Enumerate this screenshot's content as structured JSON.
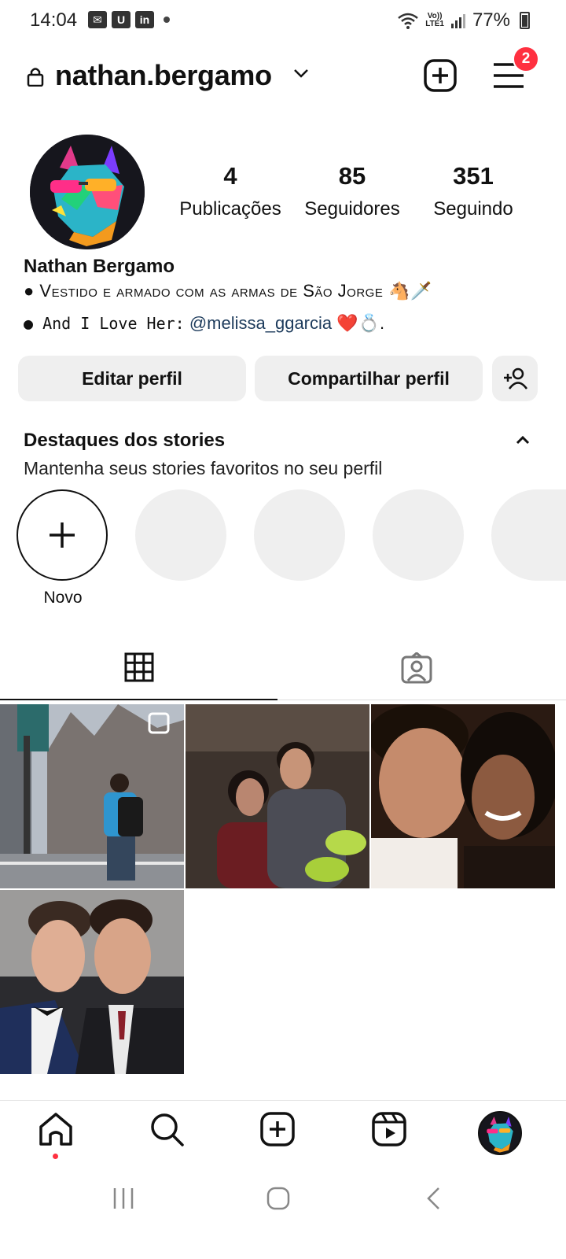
{
  "status_bar": {
    "time": "14:04",
    "notification_icons": [
      "message-icon",
      "u-app-icon",
      "linkedin-icon"
    ],
    "network": "LTE1",
    "volte": "Vo))",
    "battery": "77%"
  },
  "header": {
    "username": "nathan.bergamo",
    "notification_count": "2"
  },
  "profile": {
    "stats": [
      {
        "value": "4",
        "label": "Publicações"
      },
      {
        "value": "85",
        "label": "Seguidores"
      },
      {
        "value": "351",
        "label": "Seguindo"
      }
    ],
    "full_name": "Nathan Bergamo",
    "bio_line1": "● Vestido e armado com as armas de São Jorge 🐴🗡️",
    "bio_line2_prefix": "● And I Love Her:",
    "bio_line2_mention": "@melissa_ggarcia",
    "bio_line2_suffix": "❤️💍."
  },
  "actions": {
    "edit": "Editar perfil",
    "share": "Compartilhar perfil"
  },
  "highlights": {
    "title": "Destaques dos stories",
    "subtitle": "Mantenha seus stories favoritos no seu perfil",
    "new_label": "Novo"
  },
  "colors": {
    "badge": "#ff3040",
    "button_bg": "#efefef",
    "link": "#1d3b5c"
  }
}
